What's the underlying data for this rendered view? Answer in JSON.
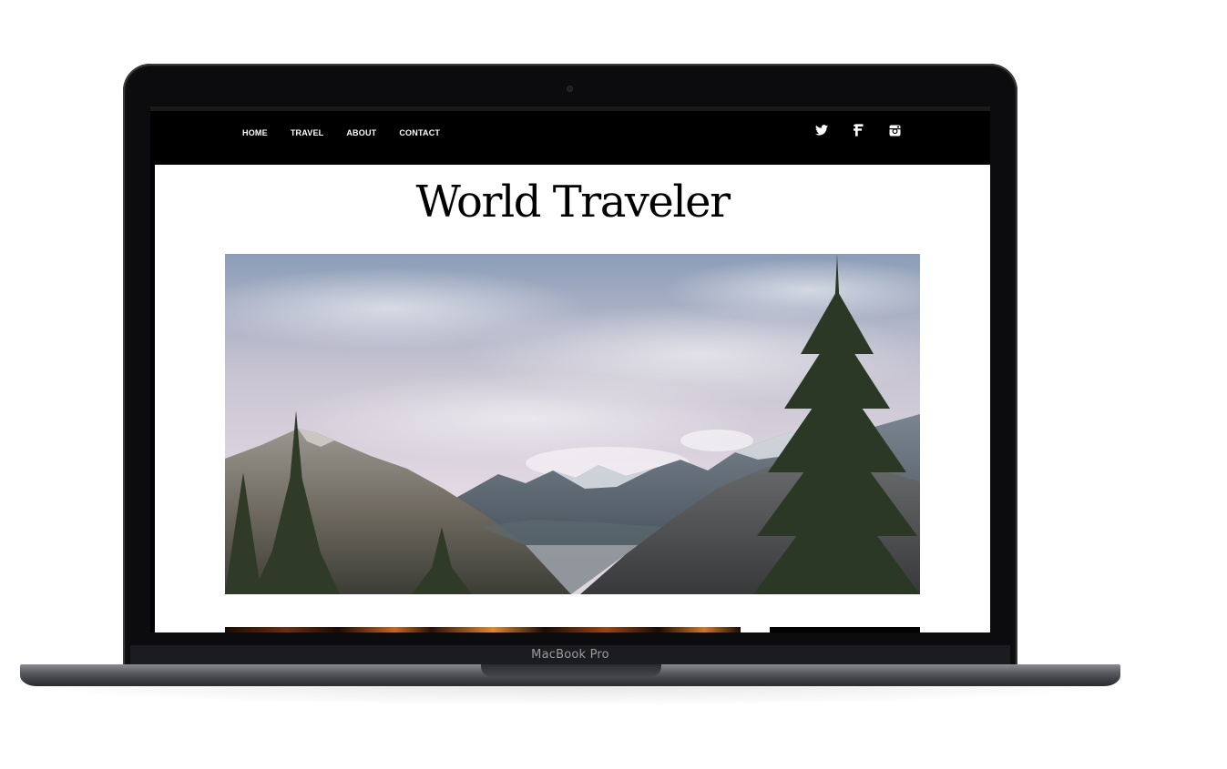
{
  "device": {
    "label": "MacBook Pro"
  },
  "site": {
    "title": "World Traveler"
  },
  "nav": {
    "items": [
      {
        "label": "HOME"
      },
      {
        "label": "TRAVEL"
      },
      {
        "label": "ABOUT"
      },
      {
        "label": "CONTACT"
      }
    ]
  },
  "social": {
    "icons": [
      "twitter-icon",
      "facebook-icon",
      "instagram-icon"
    ]
  },
  "hero": {
    "icon": "mountain-landscape-image"
  },
  "colors": {
    "navbar": "#000000",
    "page_background": "#ffffff",
    "nav_text": "#ffffff",
    "title_text": "#000000"
  }
}
